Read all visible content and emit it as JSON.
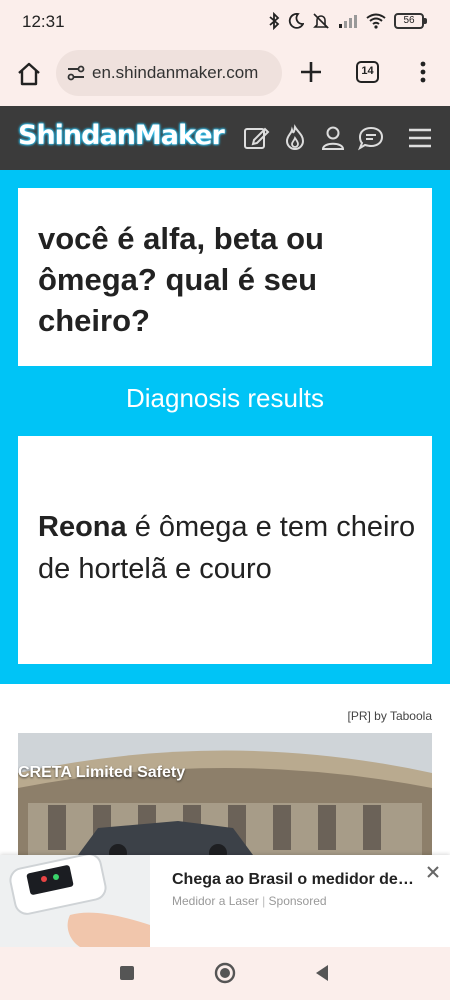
{
  "status_bar": {
    "time": "12:31",
    "battery": "56",
    "icons": [
      "bluetooth-icon",
      "moon-icon",
      "mute-icon",
      "signal-icon",
      "wifi-icon",
      "battery-icon"
    ]
  },
  "browser": {
    "url": "en.shindanmaker.com",
    "tab_count": "14"
  },
  "site_header": {
    "logo": "ShindanMaker",
    "icons": [
      "create-icon",
      "hot-icon",
      "user-icon",
      "chat-icon",
      "menu-icon"
    ]
  },
  "main": {
    "title": "você é alfa, beta ou ômega? qual é seu cheiro?",
    "results_label": "Diagnosis results",
    "result_name": "Reona",
    "result_text": " é ômega e tem cheiro de hortelã e couro"
  },
  "ad": {
    "credit": "[PR] by Taboola",
    "overlay_text": "CRETA Limited Safety",
    "sticky_headline": "Chega ao Brasil o medidor de pressão",
    "sticky_source": "Medidor a Laser",
    "sticky_sponsor": "Sponsored"
  },
  "colors": {
    "accent": "#00c4f6",
    "header_bg": "#3b3b3b",
    "chrome_bg": "#fbeeeb"
  }
}
